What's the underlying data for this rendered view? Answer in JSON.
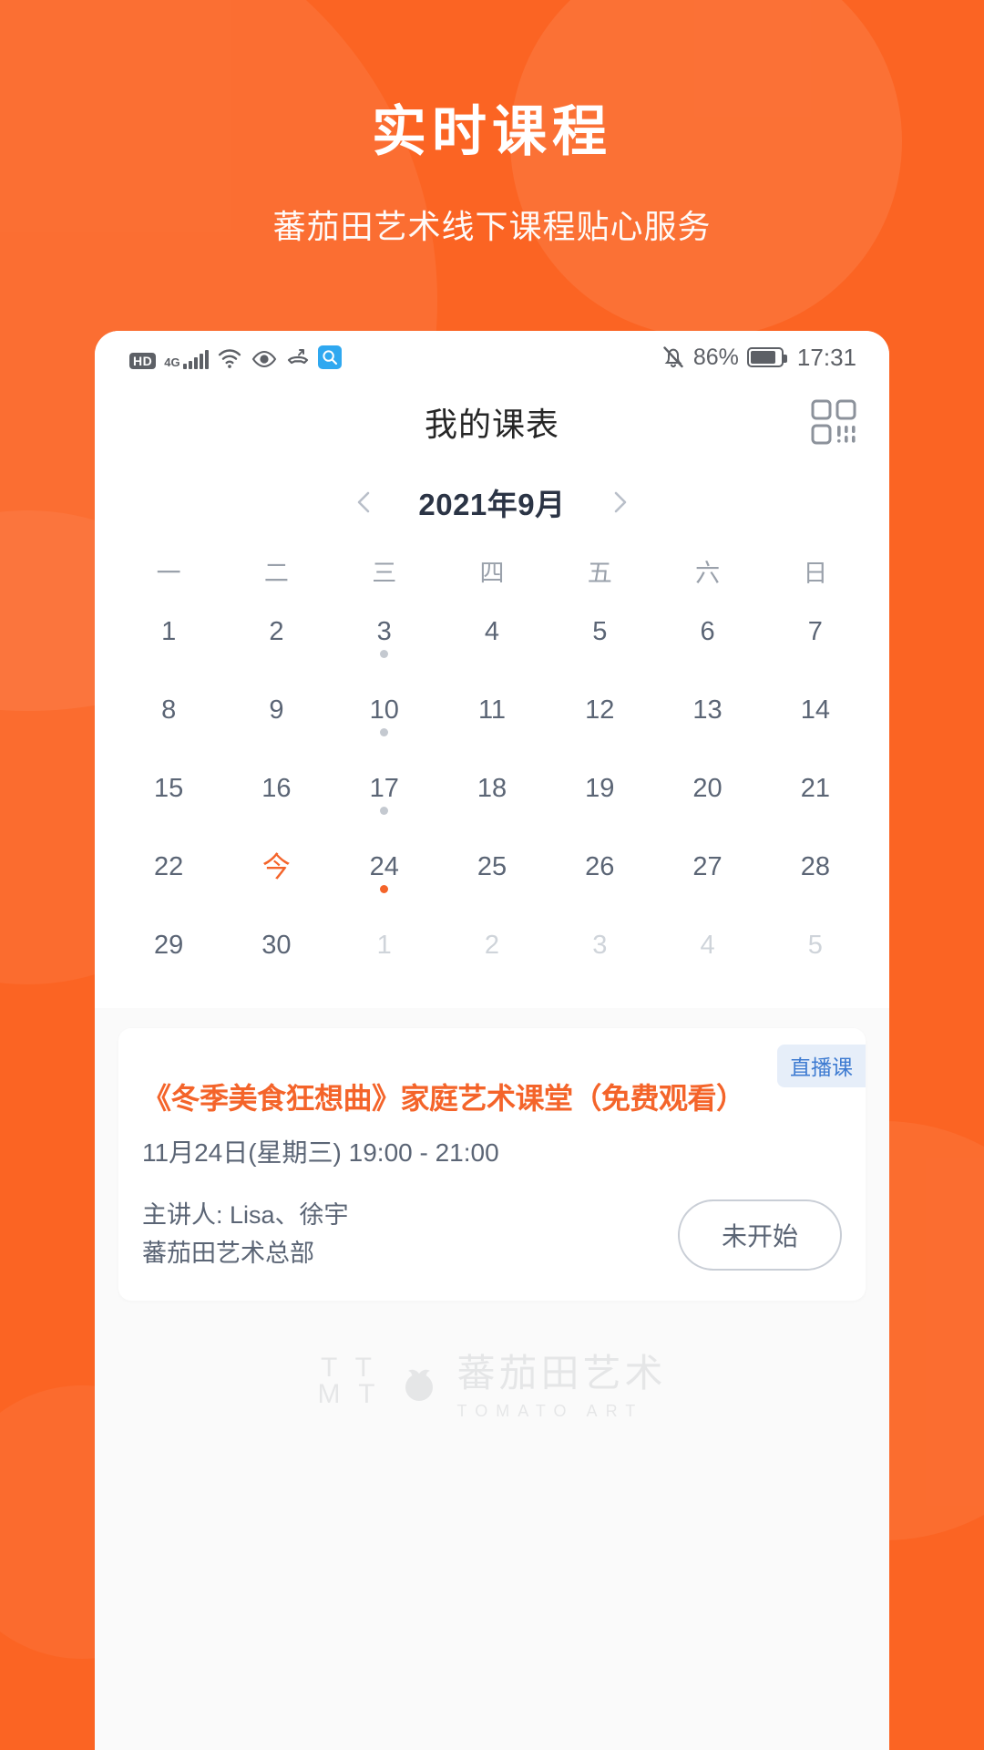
{
  "hero": {
    "title": "实时课程",
    "subtitle": "蕃茄田艺术线下课程贴心服务"
  },
  "statusbar": {
    "hd_label": "HD",
    "network_label": "4G",
    "icons": [
      "hd-icon",
      "4g-icon",
      "signal-bars-icon",
      "wifi-icon",
      "eye-icon",
      "call-divert-icon",
      "search-icon"
    ],
    "battery_percent": "86%",
    "time": "17:31",
    "mute_icon": "bell-muted-icon"
  },
  "header": {
    "title": "我的课表",
    "qr_icon": "qr-scan-icon"
  },
  "calendar": {
    "prev_icon": "chevron-left-icon",
    "next_icon": "chevron-right-icon",
    "month_label": "2021年9月",
    "weekdays": [
      "一",
      "二",
      "三",
      "四",
      "五",
      "六",
      "日"
    ],
    "weeks": [
      [
        {
          "label": "1",
          "dim": false,
          "dot": false,
          "today": false
        },
        {
          "label": "2",
          "dim": false,
          "dot": false,
          "today": false
        },
        {
          "label": "3",
          "dim": false,
          "dot": true,
          "today": false
        },
        {
          "label": "4",
          "dim": false,
          "dot": false,
          "today": false
        },
        {
          "label": "5",
          "dim": false,
          "dot": false,
          "today": false
        },
        {
          "label": "6",
          "dim": false,
          "dot": false,
          "today": false
        },
        {
          "label": "7",
          "dim": false,
          "dot": false,
          "today": false
        }
      ],
      [
        {
          "label": "8",
          "dim": false,
          "dot": false,
          "today": false
        },
        {
          "label": "9",
          "dim": false,
          "dot": false,
          "today": false
        },
        {
          "label": "10",
          "dim": false,
          "dot": true,
          "today": false
        },
        {
          "label": "11",
          "dim": false,
          "dot": false,
          "today": false
        },
        {
          "label": "12",
          "dim": false,
          "dot": false,
          "today": false
        },
        {
          "label": "13",
          "dim": false,
          "dot": false,
          "today": false
        },
        {
          "label": "14",
          "dim": false,
          "dot": false,
          "today": false
        }
      ],
      [
        {
          "label": "15",
          "dim": false,
          "dot": false,
          "today": false
        },
        {
          "label": "16",
          "dim": false,
          "dot": false,
          "today": false
        },
        {
          "label": "17",
          "dim": false,
          "dot": true,
          "today": false
        },
        {
          "label": "18",
          "dim": false,
          "dot": false,
          "today": false
        },
        {
          "label": "19",
          "dim": false,
          "dot": false,
          "today": false
        },
        {
          "label": "20",
          "dim": false,
          "dot": false,
          "today": false
        },
        {
          "label": "21",
          "dim": false,
          "dot": false,
          "today": false
        }
      ],
      [
        {
          "label": "22",
          "dim": false,
          "dot": false,
          "today": false
        },
        {
          "label": "今",
          "dim": false,
          "dot": false,
          "today": true
        },
        {
          "label": "24",
          "dim": false,
          "dot": true,
          "today": false,
          "dot_active": true
        },
        {
          "label": "25",
          "dim": false,
          "dot": false,
          "today": false
        },
        {
          "label": "26",
          "dim": false,
          "dot": false,
          "today": false
        },
        {
          "label": "27",
          "dim": false,
          "dot": false,
          "today": false
        },
        {
          "label": "28",
          "dim": false,
          "dot": false,
          "today": false
        }
      ],
      [
        {
          "label": "29",
          "dim": false,
          "dot": false,
          "today": false
        },
        {
          "label": "30",
          "dim": false,
          "dot": false,
          "today": false
        },
        {
          "label": "1",
          "dim": true,
          "dot": false,
          "today": false
        },
        {
          "label": "2",
          "dim": true,
          "dot": false,
          "today": false
        },
        {
          "label": "3",
          "dim": true,
          "dot": false,
          "today": false
        },
        {
          "label": "4",
          "dim": true,
          "dot": false,
          "today": false
        },
        {
          "label": "5",
          "dim": true,
          "dot": false,
          "today": false
        }
      ]
    ]
  },
  "course_card": {
    "badge": "直播课",
    "title": "《冬季美食狂想曲》家庭艺术课堂（免费观看）",
    "time": "11月24日(星期三) 19:00 - 21:00",
    "teacher": "主讲人: Lisa、徐宇",
    "org": "蕃茄田艺术总部",
    "status_button": "未开始"
  },
  "watermark": {
    "mark_line1": "T  T",
    "mark_line2": "M  T",
    "cn": "蕃茄田艺术",
    "en": "TOMATO ART"
  },
  "colors": {
    "brand_orange": "#FB6423",
    "accent_orange": "#F4642A",
    "badge_blue": "#3E7BD1",
    "text_dark": "#2b3445",
    "text_muted": "#5b6575"
  }
}
